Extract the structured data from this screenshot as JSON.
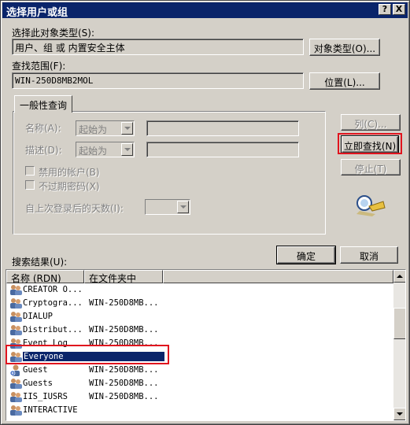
{
  "window": {
    "title": "选择用户或组",
    "help_btn": "?",
    "close_btn": "X"
  },
  "object_type": {
    "label": "选择此对象类型(S):",
    "value": "用户、组 或 内置安全主体",
    "button": "对象类型(O)..."
  },
  "location": {
    "label": "查找范围(F):",
    "value": "WIN-250D8MB2MOL",
    "button": "位置(L)..."
  },
  "general_query": {
    "tab": "一般性查询",
    "name_label": "名称(A):",
    "name_combo": "起始为",
    "desc_label": "描述(D):",
    "desc_combo": "起始为",
    "disabled_accounts": "禁用的帐户(B)",
    "non_expiring_pw": "不过期密码(X)",
    "days_label": "自上次登录后的天数(I):"
  },
  "side_buttons": {
    "columns": "列(C)...",
    "find_now": "立即查找(N)",
    "stop": "停止(T)"
  },
  "dialog_buttons": {
    "ok": "确定",
    "cancel": "取消"
  },
  "results": {
    "label": "搜索结果(U):",
    "columns": [
      "名称 (RDN)",
      "在文件夹中"
    ],
    "rows": [
      {
        "name": "CREATOR O...",
        "folder": ""
      },
      {
        "name": "Cryptogra...",
        "folder": "WIN-250D8MB..."
      },
      {
        "name": "DIALUP",
        "folder": ""
      },
      {
        "name": "Distribut...",
        "folder": "WIN-250D8MB..."
      },
      {
        "name": "Event Log",
        "folder": "WIN-250D8MB..."
      },
      {
        "name": "Everyone",
        "folder": ""
      },
      {
        "name": "Guest",
        "folder": "WIN-250D8MB..."
      },
      {
        "name": "Guests",
        "folder": "WIN-250D8MB..."
      },
      {
        "name": "IIS_IUSRS",
        "folder": "WIN-250D8MB..."
      },
      {
        "name": "INTERACTIVE",
        "folder": ""
      }
    ],
    "selected_row": "Everyone"
  },
  "colors": {
    "highlight": "#e0141e",
    "selection": "#0a246a",
    "face": "#d4d0c8"
  }
}
